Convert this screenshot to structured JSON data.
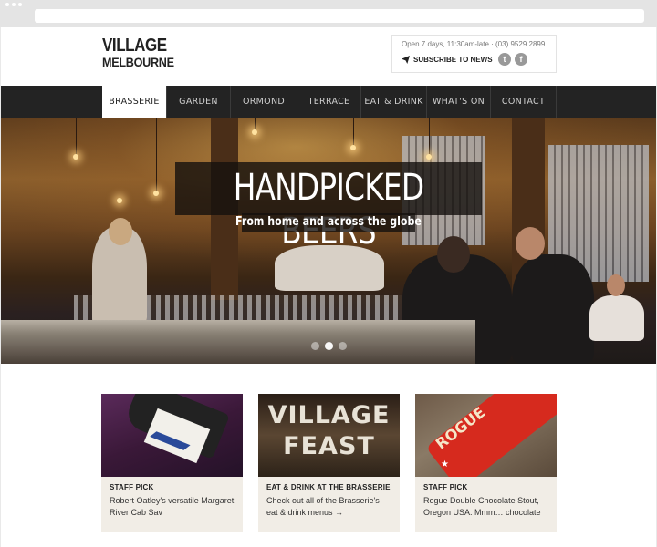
{
  "header": {
    "logo_line1": "VILLAGE",
    "logo_line2": "MELBOURNE",
    "hours": "Open 7 days, 11:30am-late · (03) 9529 2899",
    "subscribe_label": "SUBSCRIBE TO NEWS",
    "twitter_glyph": "t",
    "facebook_glyph": "f"
  },
  "nav": {
    "items": [
      "BRASSERIE",
      "GARDEN",
      "ORMOND HALL",
      "TERRACE",
      "EAT & DRINK",
      "WHAT'S ON",
      "CONTACT"
    ],
    "active": "BRASSERIE"
  },
  "hero": {
    "title": "HANDPICKED BEERS",
    "subtitle": "From home and across the globe",
    "slides": 3,
    "current_slide": 2
  },
  "cards": [
    {
      "category": "STAFF PICK",
      "text": "Robert Oatley's versatile Margaret River Cab Sav",
      "image": "wine-bottle"
    },
    {
      "category": "EAT & DRINK AT THE BRASSERIE",
      "text": "Check out all of the Brasserie's eat & drink menus →",
      "image": "village-feast",
      "image_text_1": "VILLAGE",
      "image_text_2": "FEAST"
    },
    {
      "category": "STAFF PICK",
      "text": "Rogue Double Chocolate Stout, Oregon USA. Mmm… chocolate",
      "image": "rogue-bottle",
      "image_text": "ROGUE"
    }
  ]
}
